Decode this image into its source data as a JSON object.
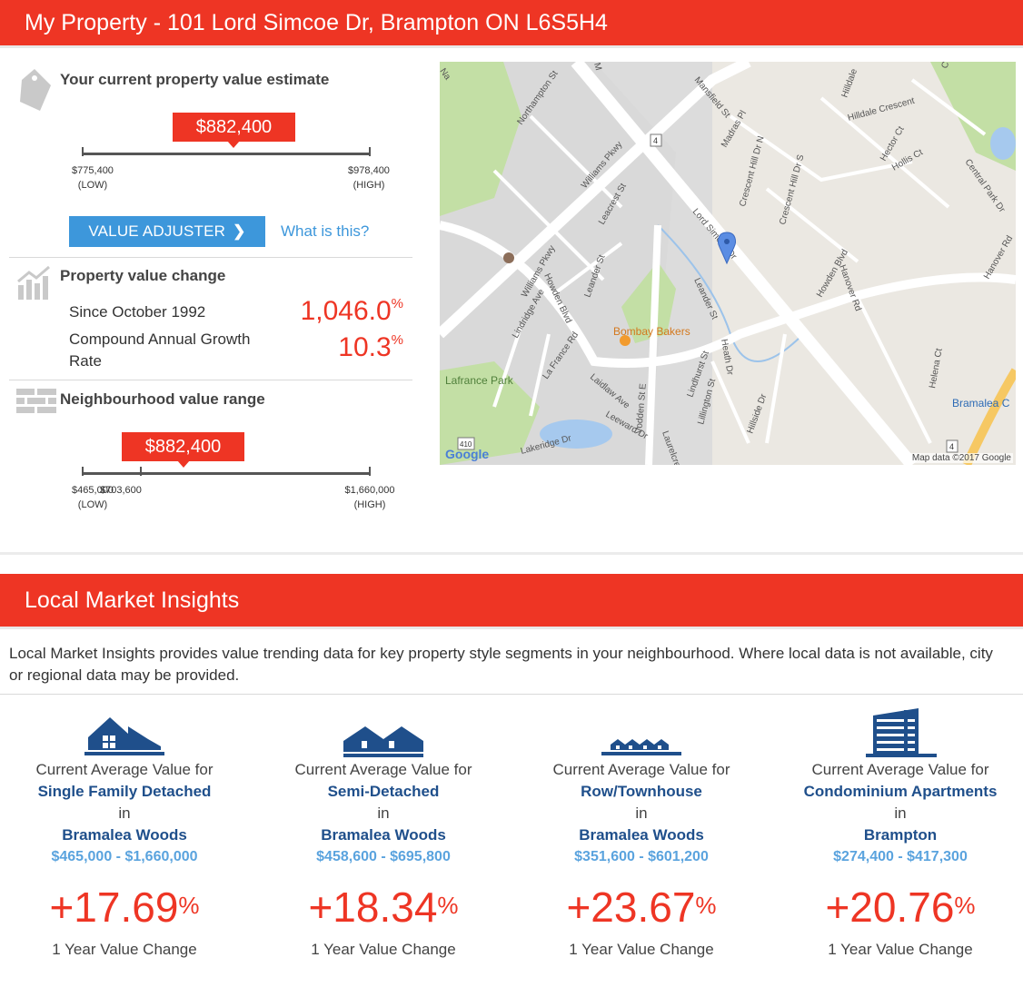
{
  "header": {
    "title": "My Property - 101 Lord Simcoe Dr, Brampton ON L6S5H4"
  },
  "estimate": {
    "title": "Your current property value estimate",
    "value": "$882,400",
    "low_value": "$775,400",
    "high_value": "$978,400",
    "low_tag": "(LOW)",
    "high_tag": "(HIGH)",
    "position_fraction": 0.526
  },
  "actions": {
    "adjuster_label": "VALUE ADJUSTER",
    "what_is_this": "What is this?"
  },
  "change": {
    "title": "Property value change",
    "since_label": "Since October 1992",
    "since_value": "1,046.0",
    "cagr_label": "Compound Annual Growth Rate",
    "cagr_value": "10.3",
    "pct_symbol": "%"
  },
  "neighbourhood": {
    "title": "Neighbourhood value range",
    "value": "$882,400",
    "low_value": "$465,000",
    "mid_value": "$703,600",
    "high_value": "$1,660,000",
    "low_tag": "(LOW)",
    "high_tag": "(HIGH)",
    "position_fraction": 0.35,
    "mid_fraction": 0.2
  },
  "map": {
    "attribution": "Map data ©2017 Google",
    "google_logo": "Google",
    "labels": {
      "northampton": "Northampton St",
      "williams_pkwy": "Williams Pkwy",
      "williams_pkwy2": "Williams Pkwy",
      "leacrest": "Leacrest St",
      "mansfield": "Mansfield St",
      "madras": "Madras Pl",
      "crescent_hill_n": "Crescent Hill Dr N",
      "crescent_hill_s": "Crescent Hill Dr S",
      "hilldale": "Hilldale Crescent",
      "hilldale2": "Hilldale",
      "hector": "Hector Ct",
      "hollis": "Hollis Ct",
      "central_park": "Central Park Dr",
      "hanover_rd2": "Hanover Rd",
      "lord_simcoe": "Lord Simcoe Dr",
      "howden_blvd": "Howden Blvd",
      "howden_blvd2": "Howden Blvd",
      "hanover_rd": "Hanover Rd",
      "leander": "Leander St",
      "leander2": "Leander St",
      "lindridge": "Lindridge Ave",
      "la_france": "La France Rd",
      "bombay": "Bombay Bakers",
      "heath": "Heath Dr",
      "lindhurst": "Lindhurst St",
      "lillington": "Lillington St",
      "hillside": "Hillside Dr",
      "helena": "Helena Ct",
      "laidlaw": "Laidlaw Ave",
      "leeward": "Leeward Dr",
      "vodden": "Vodden St E",
      "laurelcrest": "Laurelcrest St",
      "lakeridge": "Lakeridge Dr",
      "lafrance_park": "Lafrance Park",
      "bramalea": "Bramalea C",
      "shield4": "4",
      "shield4b": "4",
      "shield410": "410",
      "na": "Na",
      "m": "M",
      "c": "C"
    }
  },
  "insights": {
    "title": "Local Market Insights",
    "intro": "Local Market Insights provides value trending data for key property style segments in your neighbourhood. Where local data is not available, city or regional data may be provided.",
    "columns": [
      {
        "lead": "Current Average Value for",
        "segment": "Single Family Detached",
        "in": "in",
        "area": "Bramalea Woods",
        "range": "$465,000 - $1,660,000",
        "change": "+17.69",
        "pct": "%",
        "foot": "1 Year Value Change",
        "icon": "house-icon"
      },
      {
        "lead": "Current Average Value for",
        "segment": "Semi-Detached",
        "in": "in",
        "area": "Bramalea Woods",
        "range": "$458,600 - $695,800",
        "change": "+18.34",
        "pct": "%",
        "foot": "1 Year Value Change",
        "icon": "semi-detached-icon"
      },
      {
        "lead": "Current Average Value for",
        "segment": "Row/Townhouse",
        "in": "in",
        "area": "Bramalea Woods",
        "range": "$351,600 - $601,200",
        "change": "+23.67",
        "pct": "%",
        "foot": "1 Year Value Change",
        "icon": "townhouse-icon"
      },
      {
        "lead": "Current Average Value for",
        "segment": "Condominium Apartments",
        "in": "in",
        "area": "Brampton",
        "range": "$274,400 - $417,300",
        "change": "+20.76",
        "pct": "%",
        "foot": "1 Year Value Change",
        "icon": "condo-building-icon"
      }
    ]
  },
  "colors": {
    "brand_red": "#ee3524",
    "link_blue": "#3d97db",
    "navy": "#1f4f8b"
  }
}
